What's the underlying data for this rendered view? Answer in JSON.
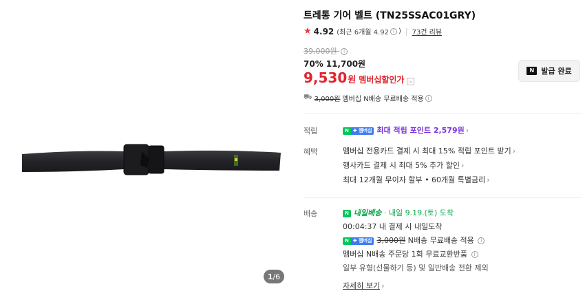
{
  "gallery": {
    "current": "1",
    "total": "/6"
  },
  "product": {
    "title": "트레통 기어 벨트 (TN25SSAC01GRY)",
    "rating": "4.92",
    "recent_rating": "(최근 6개월 4.92",
    "recent_rating_close": ")",
    "reviews": "73건 리뷰",
    "original_price": "39,000원",
    "discount_percent": "70%",
    "discount_price": "11,700원",
    "member_price_num": "9,530",
    "member_price_won": "원",
    "member_price_label": "멤버십할인가",
    "coupon_button": "발급 완료",
    "coupon_icon": "N",
    "ship_fee_strike": "3,000원",
    "ship_fee_text": "멤버십 N배송 무료배송 적용"
  },
  "points": {
    "label": "적립",
    "badge_n": "N",
    "badge_plus": "✚ 멤버십",
    "text": "최대 적립 포인트 2,579원"
  },
  "benefits": {
    "label": "혜택",
    "items": [
      "멤버십 전용카드 결제 시 최대 15% 적립 포인트 받기",
      "행사카드 결제 시 최대 5% 추가 할인",
      "최대 12개월 무이자 할부 • 60개월 특별금리"
    ]
  },
  "delivery": {
    "label": "배송",
    "badge": "N",
    "tomorrow": "내일배송",
    "date": "· 내일 9.19.(토) 도착",
    "countdown": "00:04:37 내 결제 시 내일도착",
    "fee_badge_n": "N",
    "fee_badge_plus": "✚ 멤버십",
    "fee_strike": "3,000원",
    "fee_text": "N배송 무료배송 적용",
    "exchange": "멤버십 N배송 주문당 1회 무료교환반품",
    "exclusion": "일부 유형(선물하기 등) 및 일반배송 전환 제외",
    "more": "자세히 보기"
  },
  "icons": {
    "star": "star-icon",
    "info": "info-icon",
    "chevron": "chevron-right-icon",
    "truck": "truck-icon"
  },
  "colors": {
    "accent_red": "#e3232d",
    "naver_green": "#03c75a",
    "purple": "#7a34e0"
  }
}
